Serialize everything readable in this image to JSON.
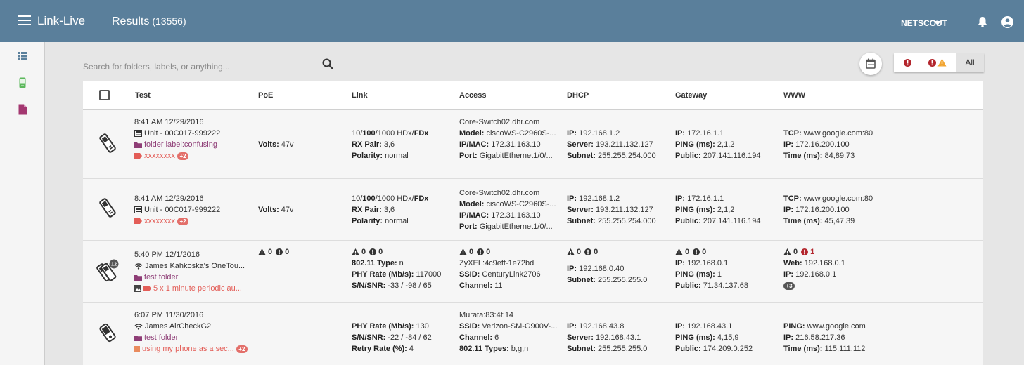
{
  "app": {
    "title": "Link-Live",
    "page": "Results",
    "count": "(13556)"
  },
  "topbar": {
    "org": "NETSCOUT"
  },
  "search": {
    "placeholder": "Search for folders, labels, or anything..."
  },
  "filters": {
    "all_label": "All"
  },
  "columns": [
    "Test",
    "PoE",
    "Link",
    "Access",
    "DHCP",
    "Gateway",
    "WWW"
  ],
  "rows": [
    {
      "test": {
        "datetime": "8:41 AM  12/29/2016",
        "unit": "Unit - 00C017-999222",
        "folder": "folder label:confusing",
        "label": "xxxxxxxx",
        "label_badge": "+2"
      },
      "poe": {
        "volts_k": "Volts:",
        "volts_v": " 47v"
      },
      "link": {
        "l1_a": "10/",
        "l1_b": "100",
        "l1_c": "/1000 HDx/",
        "l1_d": "FDx",
        "rx_k": "RX Pair:",
        "rx_v": " 3,6",
        "pol_k": "Polarity:",
        "pol_v": " normal"
      },
      "access": {
        "l1": "Core-Switch02.dhr.com",
        "model_k": "Model:",
        "model_v": " ciscoWS-C2960S-...",
        "ipmac_k": "IP/MAC:",
        "ipmac_v": " 172.31.163.10",
        "port_k": "Port:",
        "port_v": " GigabitEthernet1/0/..."
      },
      "dhcp": {
        "ip_k": "IP:",
        "ip_v": " 192.168.1.2",
        "srv_k": "Server:",
        "srv_v": " 193.211.132.127",
        "sub_k": "Subnet:",
        "sub_v": " 255.255.254.000"
      },
      "gateway": {
        "ip_k": "IP:",
        "ip_v": " 172.16.1.1",
        "ping_k": "PING (ms):",
        "ping_v": " 2,1,2",
        "pub_k": "Public:",
        "pub_v": " 207.141.116.194"
      },
      "www": {
        "tcp_k": "TCP:",
        "tcp_v": " www.google.com:80",
        "ip_k": "IP:",
        "ip_v": " 172.16.200.100",
        "time_k": "Time (ms):",
        "time_v": " 84,89,73"
      }
    },
    {
      "test": {
        "datetime": "8:41 AM  12/29/2016",
        "unit": "Unit - 00C017-999222",
        "label": "xxxxxxxx",
        "label_badge": "+2"
      },
      "poe": {
        "volts_k": "Volts:",
        "volts_v": " 47v"
      },
      "link": {
        "l1_a": "10/",
        "l1_b": "100",
        "l1_c": "/1000 HDx/",
        "l1_d": "FDx",
        "rx_k": "RX Pair:",
        "rx_v": " 3,6",
        "pol_k": "Polarity:",
        "pol_v": " normal"
      },
      "access": {
        "l1": "Core-Switch02.dhr.com",
        "model_k": "Model:",
        "model_v": " ciscoWS-C2960S-...",
        "ipmac_k": "IP/MAC:",
        "ipmac_v": " 172.31.163.10",
        "port_k": "Port:",
        "port_v": " GigabitEthernet1/0/..."
      },
      "dhcp": {
        "ip_k": "IP:",
        "ip_v": " 192.168.1.2",
        "srv_k": "Server:",
        "srv_v": " 193.211.132.127",
        "sub_k": "Subnet:",
        "sub_v": " 255.255.254.000"
      },
      "gateway": {
        "ip_k": "IP:",
        "ip_v": " 172.16.1.1",
        "ping_k": "PING (ms):",
        "ping_v": " 2,1,2",
        "pub_k": "Public:",
        "pub_v": " 207.141.116.194"
      },
      "www": {
        "tcp_k": "TCP:",
        "tcp_v": " www.google.com:80",
        "ip_k": "IP:",
        "ip_v": " 172.16.200.100",
        "time_k": "Time (ms):",
        "time_v": " 45,47,39"
      }
    },
    {
      "test": {
        "datetime": "5:40 PM  12/1/2016",
        "device_badge": "12",
        "network": "James Kahkoska's OneTou...",
        "folder": "test folder",
        "label": "5 x 1 minute periodic au..."
      },
      "poe": {
        "warn": "0",
        "err": "0"
      },
      "link": {
        "warn": "0",
        "err": "0",
        "type_k": "802.11 Type:",
        "type_v": " n",
        "phy_k": "PHY Rate (Mb/s):",
        "phy_v": " 117000",
        "snr_k": "S/N/SNR:",
        "snr_v": " -33 / -98 / 65"
      },
      "access": {
        "warn": "0",
        "err": "0",
        "l1": "ZyXEL:4c9eff-1e72bd",
        "ssid_k": "SSID:",
        "ssid_v": " CenturyLink2706",
        "ch_k": "Channel:",
        "ch_v": " 11"
      },
      "dhcp": {
        "warn": "0",
        "err": "0",
        "ip_k": "IP:",
        "ip_v": " 192.168.0.40",
        "sub_k": "Subnet:",
        "sub_v": " 255.255.255.0"
      },
      "gateway": {
        "warn": "0",
        "err": "0",
        "ip_k": "IP:",
        "ip_v": " 192.168.0.1",
        "ping_k": "PING (ms):",
        "ping_v": " 1",
        "pub_k": "Public:",
        "pub_v": " 71.34.137.68"
      },
      "www": {
        "warn": "0",
        "err": "1",
        "web_k": "Web:",
        "web_v": " 192.168.0.1",
        "ip_k": "IP:",
        "ip_v": " 192.168.0.1",
        "more": "+3"
      }
    },
    {
      "test": {
        "datetime": "6:07 PM  11/30/2016",
        "network": "James AirCheckG2",
        "folder": "test folder",
        "label": "using my phone as a sec...",
        "label_badge": "+2"
      },
      "link": {
        "phy_k": "PHY Rate (Mb/s):",
        "phy_v": " 130",
        "snr_k": "S/N/SNR:",
        "snr_v": " -22 / -84 / 62",
        "retry_k": "Retry Rate (%):",
        "retry_v": " 4"
      },
      "access": {
        "l1": "Murata:83:4f:14",
        "ssid_k": "SSID:",
        "ssid_v": " Verizon-SM-G900V-...",
        "ch_k": "Channel:",
        "ch_v": " 6",
        "types_k": "802.11 Types:",
        "types_v": " b,g,n"
      },
      "dhcp": {
        "ip_k": "IP:",
        "ip_v": " 192.168.43.8",
        "srv_k": "Server:",
        "srv_v": " 192.168.43.1",
        "sub_k": "Subnet:",
        "sub_v": " 255.255.255.0"
      },
      "gateway": {
        "ip_k": "IP:",
        "ip_v": " 192.168.43.1",
        "ping_k": "PING (ms):",
        "ping_v": " 4,15,9",
        "pub_k": "Public:",
        "pub_v": " 174.209.0.252"
      },
      "www": {
        "ping_k": "PING:",
        "ping_v": " www.google.com",
        "ip_k": "IP:",
        "ip_v": " 216.58.217.36",
        "time_k": "Time (ms):",
        "time_v": " 115,111,112"
      }
    }
  ],
  "colors": {
    "topbar": "#5a7f9b",
    "purple": "#8e3d76",
    "red": "#e35d57",
    "error": "#b3262d",
    "warning": "#f2a531"
  }
}
